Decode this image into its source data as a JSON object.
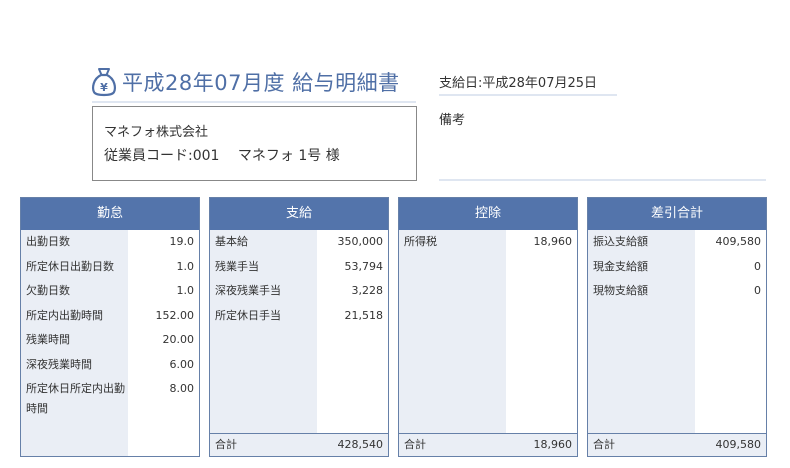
{
  "header": {
    "title": "平成28年07月度 給与明細書",
    "pay_date": "支給日:平成28年07月25日",
    "icon": "money-bag-icon"
  },
  "employee": {
    "company": "マネフォ株式会社",
    "line": "従業員コード:001　 マネフォ 1号 様"
  },
  "remarks": {
    "label": "備考"
  },
  "attendance": {
    "title": "勤怠",
    "rows": [
      {
        "label": "出勤日数",
        "value": "19.0"
      },
      {
        "label": "所定休日出勤日数",
        "value": "1.0"
      },
      {
        "label": "欠勤日数",
        "value": "1.0"
      },
      {
        "label": "所定内出勤時間",
        "value": "152.00"
      },
      {
        "label": "残業時間",
        "value": "20.00"
      },
      {
        "label": "深夜残業時間",
        "value": "6.00"
      },
      {
        "label": "所定休日所定内出勤時間",
        "value": "8.00"
      }
    ]
  },
  "payment": {
    "title": "支給",
    "rows": [
      {
        "label": "基本給",
        "value": "350,000"
      },
      {
        "label": "残業手当",
        "value": "53,794"
      },
      {
        "label": "深夜残業手当",
        "value": "3,228"
      },
      {
        "label": "所定休日手当",
        "value": "21,518"
      }
    ],
    "total_label": "合計",
    "total_value": "428,540"
  },
  "deduction": {
    "title": "控除",
    "rows": [
      {
        "label": "所得税",
        "value": "18,960"
      }
    ],
    "total_label": "合計",
    "total_value": "18,960"
  },
  "net": {
    "title": "差引合計",
    "rows": [
      {
        "label": "振込支給額",
        "value": "409,580"
      },
      {
        "label": "現金支給額",
        "value": "0"
      },
      {
        "label": "現物支給額",
        "value": "0"
      }
    ],
    "total_label": "合計",
    "total_value": "409,580"
  },
  "colors": {
    "accent": "#5374ab",
    "title": "#4f6fa6",
    "label_bg": "#eaeef5"
  }
}
